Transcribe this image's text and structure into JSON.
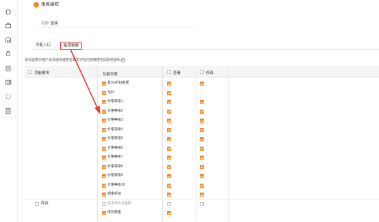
{
  "header": {
    "title": "角色授权"
  },
  "name_field": {
    "label": "名称",
    "value": "销售"
  },
  "tabs": [
    {
      "label": "功能入口",
      "active": false
    },
    {
      "label": "敏感数据",
      "active": true
    }
  ],
  "hint": "未勾选表示用户无法修改或查看相关字段内容敏感字段影响说明",
  "hint_icon": "?",
  "columns": {
    "module": "功能模块",
    "list": "功能列表",
    "view": "查看",
    "edit": "修改"
  },
  "rows": [
    {
      "label": "售价/折扣金额",
      "view": true,
      "edit": true
    },
    {
      "label": "毛利",
      "view": true,
      "edit": false
    },
    {
      "label": "价格等级1",
      "view": true,
      "edit": true
    },
    {
      "label": "价格等级2",
      "view": true,
      "edit": true
    },
    {
      "label": "价格等级3",
      "view": true,
      "edit": true
    },
    {
      "label": "价格等级4",
      "view": true,
      "edit": true
    },
    {
      "label": "价格等级5",
      "view": true,
      "edit": true
    },
    {
      "label": "价格等级6",
      "view": true,
      "edit": true
    },
    {
      "label": "价格等级7",
      "view": true,
      "edit": true
    },
    {
      "label": "价格等级8",
      "view": true,
      "edit": true
    },
    {
      "label": "价格等级9",
      "view": true,
      "edit": true
    },
    {
      "label": "价格等级10",
      "view": true,
      "edit": true
    },
    {
      "label": "现金折扣",
      "view": true,
      "edit": true
    },
    {
      "label": "成本单价及金额",
      "view": false,
      "edit": false,
      "module": "库存",
      "muted": true
    },
    {
      "label": "库存数量",
      "view": true,
      "edit": false
    }
  ],
  "colors": {
    "accent": "#f08a24",
    "highlight": "#e8362b"
  },
  "rail_icons": [
    "home-icon",
    "shop-icon",
    "building-icon",
    "money-bag-icon",
    "document-icon",
    "id-card-icon",
    "loading-icon",
    "file-icon"
  ]
}
